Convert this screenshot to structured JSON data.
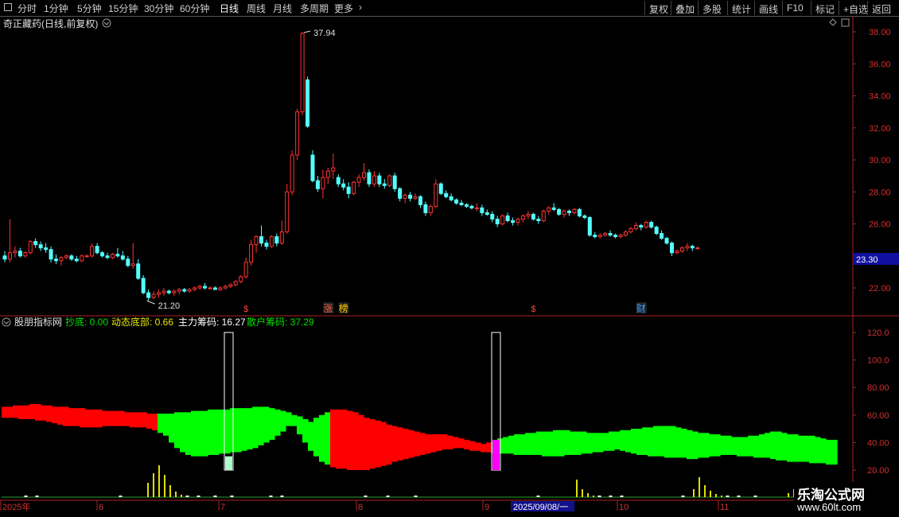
{
  "toolbar": {
    "periods": [
      "分时",
      "1分钟",
      "5分钟",
      "15分钟",
      "30分钟",
      "60分钟",
      "日线",
      "周线",
      "月线",
      "多周期",
      "更多"
    ],
    "active_period": "日线",
    "right_buttons": [
      "复权",
      "叠加",
      "多股",
      "统计",
      "画线",
      "F10",
      "标记",
      "+自选",
      "返回"
    ]
  },
  "main_panel": {
    "title": "奇正藏药(日线,前复权)",
    "high_label": "37.94",
    "low_label": "21.20",
    "current_price": "23.30",
    "price_ticks": [
      "38.00",
      "36.00",
      "34.00",
      "32.00",
      "30.00",
      "28.00",
      "26.00",
      "24.00",
      "22.00"
    ],
    "markers": [
      {
        "text": "$",
        "color": "#ff4040"
      },
      {
        "text": "涨",
        "color": "#ff6040"
      },
      {
        "text": "榜",
        "color": "#ffcc00"
      },
      {
        "text": "$",
        "color": "#ff4040"
      },
      {
        "text": "财",
        "color": "#40a0ff"
      }
    ]
  },
  "indicator_panel": {
    "name": "股朋指标网",
    "items": [
      {
        "label": "抄底:",
        "value": "0.00",
        "color": "#00e000"
      },
      {
        "label": "动态底部:",
        "value": "0.66",
        "color": "#e8e800"
      },
      {
        "label": "主力筹码:",
        "value": "16.27",
        "color": "#ffffff"
      },
      {
        "label": "散户筹码:",
        "value": "37.29",
        "color": "#00e000"
      }
    ],
    "ticks": [
      "120.0",
      "100.0",
      "80.00",
      "60.00",
      "40.00",
      "20.00"
    ]
  },
  "timeline": {
    "labels": [
      "2025年",
      "6",
      "7",
      "8",
      "9",
      "10",
      "11"
    ],
    "cursor_date": "2025/09/08/一"
  },
  "watermark": {
    "title": "乐淘公式网",
    "url": "www.60lt.com"
  },
  "colors": {
    "up": "#ff3333",
    "down": "#54ffff",
    "axis": "#b02020",
    "bull": "#00ff00",
    "bear": "#ff0000",
    "signal": "#ff00ff",
    "volume": "#e0e000"
  },
  "chart_data": {
    "type": "candlestick",
    "price_range": [
      21.0,
      38.6
    ],
    "candles": [
      [
        24.0,
        24.3,
        23.6,
        23.8
      ],
      [
        23.8,
        26.3,
        23.6,
        24.2
      ],
      [
        24.2,
        24.6,
        23.9,
        24.3
      ],
      [
        24.3,
        24.5,
        23.9,
        24.0
      ],
      [
        24.0,
        24.3,
        23.9,
        24.2
      ],
      [
        24.2,
        25.0,
        24.1,
        24.9
      ],
      [
        24.9,
        25.1,
        24.5,
        24.7
      ],
      [
        24.7,
        24.9,
        24.3,
        24.5
      ],
      [
        24.5,
        24.8,
        24.2,
        24.4
      ],
      [
        24.4,
        24.6,
        23.6,
        23.8
      ],
      [
        23.8,
        24.1,
        23.5,
        23.7
      ],
      [
        23.7,
        24.0,
        23.4,
        23.9
      ],
      [
        23.9,
        24.1,
        23.8,
        24.0
      ],
      [
        24.0,
        24.1,
        23.7,
        23.8
      ],
      [
        23.8,
        24.0,
        23.6,
        23.7
      ],
      [
        23.7,
        24.1,
        23.6,
        24.0
      ],
      [
        24.0,
        24.1,
        23.9,
        24.0
      ],
      [
        24.0,
        24.8,
        23.9,
        24.6
      ],
      [
        24.6,
        24.8,
        24.1,
        24.2
      ],
      [
        24.2,
        24.3,
        23.9,
        24.0
      ],
      [
        24.0,
        24.2,
        23.8,
        23.9
      ],
      [
        23.9,
        24.2,
        23.8,
        24.1
      ],
      [
        24.1,
        24.5,
        23.9,
        24.0
      ],
      [
        24.0,
        24.3,
        23.7,
        23.8
      ],
      [
        23.8,
        24.0,
        23.3,
        23.4
      ],
      [
        23.4,
        24.8,
        23.2,
        23.5
      ],
      [
        23.5,
        23.8,
        22.5,
        22.6
      ],
      [
        22.6,
        22.8,
        21.6,
        21.7
      ],
      [
        21.7,
        21.9,
        21.2,
        21.4
      ],
      [
        21.4,
        21.8,
        21.3,
        21.6
      ],
      [
        21.6,
        21.9,
        21.4,
        21.7
      ],
      [
        21.7,
        22.0,
        21.5,
        21.8
      ],
      [
        21.8,
        21.9,
        21.6,
        21.7
      ],
      [
        21.7,
        21.9,
        21.5,
        21.8
      ],
      [
        21.8,
        22.0,
        21.6,
        21.9
      ],
      [
        21.9,
        22.0,
        21.7,
        21.8
      ],
      [
        21.8,
        22.0,
        21.7,
        21.9
      ],
      [
        21.9,
        22.1,
        21.8,
        22.0
      ],
      [
        22.0,
        22.2,
        21.9,
        22.1
      ],
      [
        22.1,
        22.3,
        21.9,
        22.0
      ],
      [
        22.0,
        22.1,
        21.9,
        22.0
      ],
      [
        22.0,
        22.1,
        21.9,
        21.9
      ],
      [
        21.9,
        22.1,
        21.8,
        22.0
      ],
      [
        22.0,
        22.2,
        21.9,
        22.1
      ],
      [
        22.1,
        22.3,
        22.0,
        22.2
      ],
      [
        22.2,
        22.5,
        22.1,
        22.4
      ],
      [
        22.4,
        22.8,
        22.3,
        22.7
      ],
      [
        22.7,
        23.9,
        22.6,
        23.6
      ],
      [
        23.6,
        25.0,
        23.4,
        24.7
      ],
      [
        24.7,
        25.3,
        24.2,
        25.2
      ],
      [
        25.2,
        25.9,
        24.6,
        24.8
      ],
      [
        24.8,
        25.0,
        24.4,
        24.6
      ],
      [
        24.6,
        25.3,
        24.5,
        25.2
      ],
      [
        25.2,
        25.4,
        24.6,
        24.8
      ],
      [
        24.8,
        26.2,
        24.7,
        25.5
      ],
      [
        25.5,
        28.5,
        25.4,
        28.0
      ],
      [
        28.0,
        30.6,
        27.8,
        30.3
      ],
      [
        30.3,
        33.2,
        30.0,
        33.0
      ],
      [
        33.0,
        38.0,
        32.8,
        37.9
      ],
      [
        35.0,
        35.2,
        32.0,
        32.1
      ],
      [
        30.3,
        30.6,
        28.6,
        28.7
      ],
      [
        28.7,
        29.0,
        28.0,
        28.2
      ],
      [
        28.2,
        29.4,
        27.6,
        28.9
      ],
      [
        28.9,
        29.5,
        28.5,
        29.3
      ],
      [
        29.3,
        30.4,
        28.8,
        29.5
      ],
      [
        28.9,
        29.1,
        28.3,
        28.5
      ],
      [
        28.5,
        28.8,
        28.1,
        28.3
      ],
      [
        28.3,
        28.6,
        27.6,
        27.9
      ],
      [
        27.9,
        28.7,
        27.8,
        28.6
      ],
      [
        28.6,
        29.1,
        28.3,
        28.9
      ],
      [
        28.9,
        29.8,
        28.7,
        29.2
      ],
      [
        29.2,
        29.4,
        28.3,
        28.5
      ],
      [
        28.5,
        29.3,
        28.3,
        29.0
      ],
      [
        29.0,
        29.2,
        28.3,
        28.5
      ],
      [
        28.5,
        28.8,
        28.2,
        28.4
      ],
      [
        28.4,
        29.1,
        28.3,
        29.0
      ],
      [
        29.0,
        29.2,
        28.0,
        28.2
      ],
      [
        28.2,
        28.3,
        27.4,
        27.6
      ],
      [
        27.6,
        27.9,
        27.3,
        27.8
      ],
      [
        27.8,
        28.0,
        27.4,
        27.6
      ],
      [
        27.6,
        27.9,
        27.5,
        27.7
      ],
      [
        27.7,
        27.8,
        27.0,
        27.2
      ],
      [
        27.2,
        27.4,
        26.5,
        26.7
      ],
      [
        26.7,
        27.2,
        26.5,
        27.1
      ],
      [
        27.1,
        28.8,
        27.0,
        28.5
      ],
      [
        28.5,
        28.6,
        27.8,
        27.9
      ],
      [
        27.9,
        28.1,
        27.6,
        27.7
      ],
      [
        27.7,
        27.9,
        27.4,
        27.5
      ],
      [
        27.5,
        27.6,
        27.2,
        27.3
      ],
      [
        27.3,
        27.5,
        27.1,
        27.2
      ],
      [
        27.2,
        27.3,
        27.0,
        27.1
      ],
      [
        27.1,
        27.2,
        26.9,
        27.0
      ],
      [
        27.0,
        27.3,
        26.8,
        27.0
      ],
      [
        27.0,
        27.2,
        26.5,
        26.7
      ],
      [
        26.7,
        26.9,
        26.5,
        26.6
      ],
      [
        26.6,
        26.8,
        26.1,
        26.3
      ],
      [
        26.3,
        26.5,
        25.8,
        26.0
      ],
      [
        26.0,
        26.6,
        25.9,
        26.5
      ],
      [
        26.5,
        26.7,
        26.1,
        26.2
      ],
      [
        26.2,
        26.4,
        25.9,
        26.1
      ],
      [
        26.1,
        26.4,
        25.9,
        26.3
      ],
      [
        26.3,
        26.6,
        26.1,
        26.5
      ],
      [
        26.5,
        26.8,
        26.3,
        26.6
      ],
      [
        26.6,
        26.7,
        26.2,
        26.3
      ],
      [
        26.3,
        26.5,
        26.0,
        26.2
      ],
      [
        26.2,
        26.9,
        26.1,
        26.8
      ],
      [
        26.8,
        27.1,
        26.6,
        27.0
      ],
      [
        27.0,
        27.3,
        26.8,
        26.9
      ],
      [
        26.9,
        27.0,
        26.5,
        26.6
      ],
      [
        26.6,
        26.9,
        26.4,
        26.8
      ],
      [
        26.8,
        26.9,
        26.5,
        26.7
      ],
      [
        26.7,
        27.0,
        26.6,
        26.9
      ],
      [
        26.9,
        27.0,
        26.4,
        26.5
      ],
      [
        26.5,
        26.6,
        26.3,
        26.4
      ],
      [
        26.4,
        26.5,
        25.2,
        25.3
      ],
      [
        25.3,
        25.5,
        25.1,
        25.2
      ],
      [
        25.2,
        25.4,
        25.1,
        25.3
      ],
      [
        25.3,
        25.5,
        25.2,
        25.4
      ],
      [
        25.4,
        25.6,
        25.2,
        25.3
      ],
      [
        25.3,
        25.4,
        25.1,
        25.2
      ],
      [
        25.2,
        25.4,
        25.1,
        25.3
      ],
      [
        25.3,
        25.6,
        25.2,
        25.5
      ],
      [
        25.5,
        25.8,
        25.4,
        25.7
      ],
      [
        25.7,
        26.1,
        25.6,
        25.9
      ],
      [
        25.9,
        26.0,
        25.6,
        25.8
      ],
      [
        25.8,
        26.2,
        25.7,
        26.1
      ],
      [
        26.1,
        26.2,
        25.7,
        25.8
      ],
      [
        25.8,
        25.9,
        25.3,
        25.4
      ],
      [
        25.4,
        25.6,
        25.0,
        25.1
      ],
      [
        25.1,
        25.2,
        24.7,
        24.8
      ],
      [
        24.8,
        24.9,
        24.0,
        24.2
      ],
      [
        24.2,
        24.4,
        24.1,
        24.3
      ],
      [
        24.3,
        24.6,
        24.2,
        24.5
      ],
      [
        24.5,
        24.8,
        24.3,
        24.6
      ],
      [
        24.6,
        24.7,
        24.3,
        24.5
      ],
      [
        24.5,
        24.6,
        24.4,
        24.5
      ]
    ],
    "markers": [
      {
        "index": 47,
        "text": "$"
      },
      {
        "index": 63,
        "text": "涨"
      },
      {
        "index": 66,
        "text": "榜"
      },
      {
        "index": 103,
        "text": "$"
      },
      {
        "index": 124,
        "text": "财"
      }
    ],
    "indicator": {
      "range": [
        15,
        125
      ],
      "top": [
        66,
        66,
        67,
        67,
        67,
        68,
        68,
        67,
        67,
        66,
        66,
        66,
        65,
        65,
        65,
        64,
        64,
        64,
        63,
        63,
        63,
        63,
        62,
        62,
        62,
        62,
        61,
        61,
        61,
        61,
        61,
        62,
        62,
        62,
        63,
        63,
        63,
        64,
        64,
        64,
        64,
        65,
        65,
        65,
        65,
        66,
        66,
        66,
        65,
        64,
        63,
        62,
        60,
        59,
        57,
        55,
        58,
        60,
        62,
        64,
        64,
        64,
        63,
        62,
        60,
        58,
        57,
        56,
        55,
        53,
        52,
        51,
        50,
        49,
        48,
        47,
        46,
        46,
        46,
        46,
        45,
        44,
        43,
        42,
        41,
        40,
        39,
        40,
        41,
        43,
        44,
        45,
        46,
        46,
        47,
        47,
        48,
        48,
        48,
        49,
        49,
        49,
        48,
        48,
        48,
        47,
        47,
        47,
        47,
        48,
        48,
        49,
        49,
        50,
        50,
        51,
        51,
        52,
        52,
        52,
        52,
        51,
        50,
        49,
        48,
        47,
        47,
        46,
        46,
        45,
        45,
        44,
        44,
        44,
        45,
        45,
        46,
        47,
        48,
        48,
        47,
        46,
        46,
        45,
        45,
        45,
        44,
        43,
        42,
        42
      ],
      "bottom": [
        58,
        58,
        58,
        57,
        57,
        57,
        56,
        56,
        55,
        54,
        53,
        52,
        52,
        52,
        51,
        51,
        51,
        51,
        52,
        52,
        52,
        52,
        52,
        51,
        51,
        51,
        50,
        49,
        47,
        45,
        40,
        36,
        33,
        31,
        30,
        30,
        30,
        31,
        31,
        32,
        32,
        33,
        33,
        34,
        35,
        36,
        38,
        40,
        42,
        45,
        48,
        52,
        52,
        46,
        40,
        34,
        30,
        26,
        24,
        22,
        21,
        21,
        20,
        20,
        20,
        20,
        21,
        22,
        23,
        24,
        26,
        27,
        28,
        29,
        30,
        31,
        32,
        33,
        34,
        35,
        35,
        36,
        36,
        35,
        34,
        34,
        33,
        33,
        32,
        32,
        32,
        32,
        31,
        31,
        31,
        31,
        31,
        30,
        30,
        30,
        30,
        31,
        31,
        31,
        32,
        32,
        33,
        33,
        34,
        34,
        35,
        34,
        33,
        32,
        31,
        31,
        30,
        30,
        30,
        29,
        29,
        29,
        29,
        28,
        28,
        29,
        29,
        30,
        30,
        31,
        31,
        31,
        30,
        30,
        30,
        29,
        29,
        29,
        28,
        27,
        27,
        26,
        26,
        26,
        26,
        25,
        25,
        25,
        24,
        24
      ],
      "volume_bars": [
        0,
        0,
        0,
        0,
        1,
        0,
        1,
        0,
        0,
        0,
        0,
        0,
        0,
        0,
        0,
        0,
        0,
        0,
        0,
        0,
        0,
        1,
        0,
        0,
        0,
        0,
        18,
        30,
        40,
        28,
        15,
        7,
        3,
        1,
        0,
        1,
        0,
        0,
        1,
        0,
        0,
        1,
        0,
        0,
        0,
        0,
        0,
        0,
        1,
        0,
        1,
        0,
        0,
        0,
        0,
        0,
        0,
        0,
        0,
        0,
        0,
        0,
        0,
        0,
        0,
        1,
        0,
        0,
        0,
        1,
        0,
        0,
        0,
        0,
        1,
        0,
        0,
        0,
        0,
        0,
        0,
        0,
        0,
        0,
        0,
        0,
        0,
        0,
        0,
        0,
        0,
        0,
        0,
        0,
        0,
        0,
        1,
        0,
        0,
        0,
        0,
        0,
        0,
        22,
        10,
        5,
        2,
        1,
        0,
        1,
        0,
        1,
        0,
        0,
        0,
        0,
        0,
        0,
        0,
        0,
        0,
        0,
        1,
        0,
        10,
        25,
        15,
        8,
        4,
        2,
        1,
        0,
        1,
        0,
        0,
        1,
        0,
        0,
        0,
        0,
        0,
        5,
        10,
        3,
        0,
        0,
        0,
        0,
        0,
        0
      ],
      "signal_boxes": [
        {
          "index": 40,
          "filled": 10,
          "color": "#aaffcc"
        },
        {
          "index": 88,
          "filled": 22,
          "color": "#ff00ff"
        }
      ]
    }
  }
}
